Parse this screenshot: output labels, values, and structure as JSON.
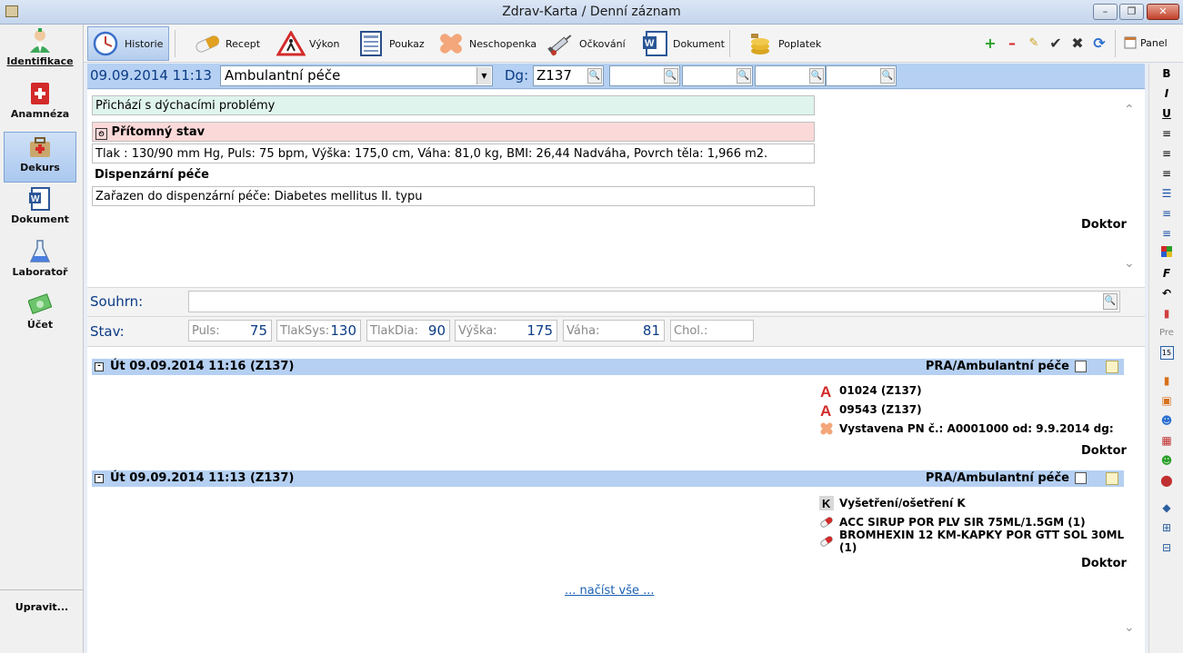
{
  "window": {
    "title": "Zdrav-Karta / Denní záznam"
  },
  "sidebar": {
    "items": [
      {
        "label": "Identifikace",
        "icon": "doctor-icon"
      },
      {
        "label": "Anamnéza",
        "icon": "medical-book-icon"
      },
      {
        "label": "Dekurs",
        "icon": "medical-bag-icon"
      },
      {
        "label": "Dokument",
        "icon": "word-document-icon"
      },
      {
        "label": "Laboratoř",
        "icon": "flask-icon"
      },
      {
        "label": "Účet",
        "icon": "money-icon"
      }
    ],
    "footer": "Upravit..."
  },
  "toolbar": {
    "buttons": [
      {
        "label": "Historie",
        "icon": "clock-icon"
      },
      {
        "label": "Recept",
        "icon": "pill-icon"
      },
      {
        "label": "Výkon",
        "icon": "warning-sign-icon"
      },
      {
        "label": "Poukaz",
        "icon": "form-icon"
      },
      {
        "label": "Neschopenka",
        "icon": "bandage-icon"
      },
      {
        "label": "Očkování",
        "icon": "syringe-icon"
      },
      {
        "label": "Dokument",
        "icon": "word-document-icon"
      },
      {
        "label": "Poplatek",
        "icon": "coins-icon"
      }
    ],
    "panel": "Panel"
  },
  "header": {
    "datetime": "09.09.2014 11:13",
    "type": "Ambulantní péče",
    "dg_label": "Dg:",
    "dg_values": [
      "Z137",
      "",
      "",
      "",
      ""
    ]
  },
  "right_toolbar": {
    "bold": "B",
    "italic": "I",
    "underline": "U",
    "font": "F",
    "pre": "Pre",
    "calendar_day": "15"
  },
  "current_record": {
    "complaint": "Přichází s dýchacími problémy",
    "status_heading": "Přítomný stav",
    "status_text": "Tlak : 130/90 mm Hg, Puls: 75 bpm, Výška: 175,0 cm, Váha: 81,0 kg, BMI: 26,44 Nadváha, Povrch těla: 1,966 m2.",
    "disp_heading": "Dispenzární péče",
    "disp_text": "Zařazen do dispenzární péče: Diabetes mellitus II. typu",
    "signature": "Doktor"
  },
  "summary": {
    "label": "Souhrn:",
    "value": ""
  },
  "vitals": {
    "label": "Stav:",
    "fields": [
      {
        "label": "Puls:",
        "value": "75"
      },
      {
        "label": "TlakSys:",
        "value": "130"
      },
      {
        "label": "TlakDia:",
        "value": "90"
      },
      {
        "label": "Výška:",
        "value": "175"
      },
      {
        "label": "Váha:",
        "value": "81"
      },
      {
        "label": "Chol.:",
        "value": ""
      }
    ]
  },
  "history": [
    {
      "datetime": "Út 09.09.2014 11:16 (Z137)",
      "category": "PRA/Ambulantní péče",
      "items": [
        {
          "text": "01024 (Z137)",
          "icon": "procedure-a-icon"
        },
        {
          "text": "09543 (Z137)",
          "icon": "procedure-a-icon"
        },
        {
          "text": "Vystavena PN č.: A0001000 od: 9.9.2014 dg:",
          "icon": "bandage-icon"
        }
      ],
      "signature": "Doktor"
    },
    {
      "datetime": "Út 09.09.2014 11:13 (Z137)",
      "category": "PRA/Ambulantní péče",
      "items": [
        {
          "text": "Vyšetření/ošetření K",
          "icon": "k-badge-icon"
        },
        {
          "text": "ACC SIRUP POR PLV SIR 75ML/1.5GM (1)",
          "icon": "pill-icon"
        },
        {
          "text": "BROMHEXIN 12 KM-KAPKY POR GTT SOL 30ML (1)",
          "icon": "pill-icon"
        }
      ],
      "signature": "Doktor"
    }
  ],
  "load_all": "... načíst vše ..."
}
